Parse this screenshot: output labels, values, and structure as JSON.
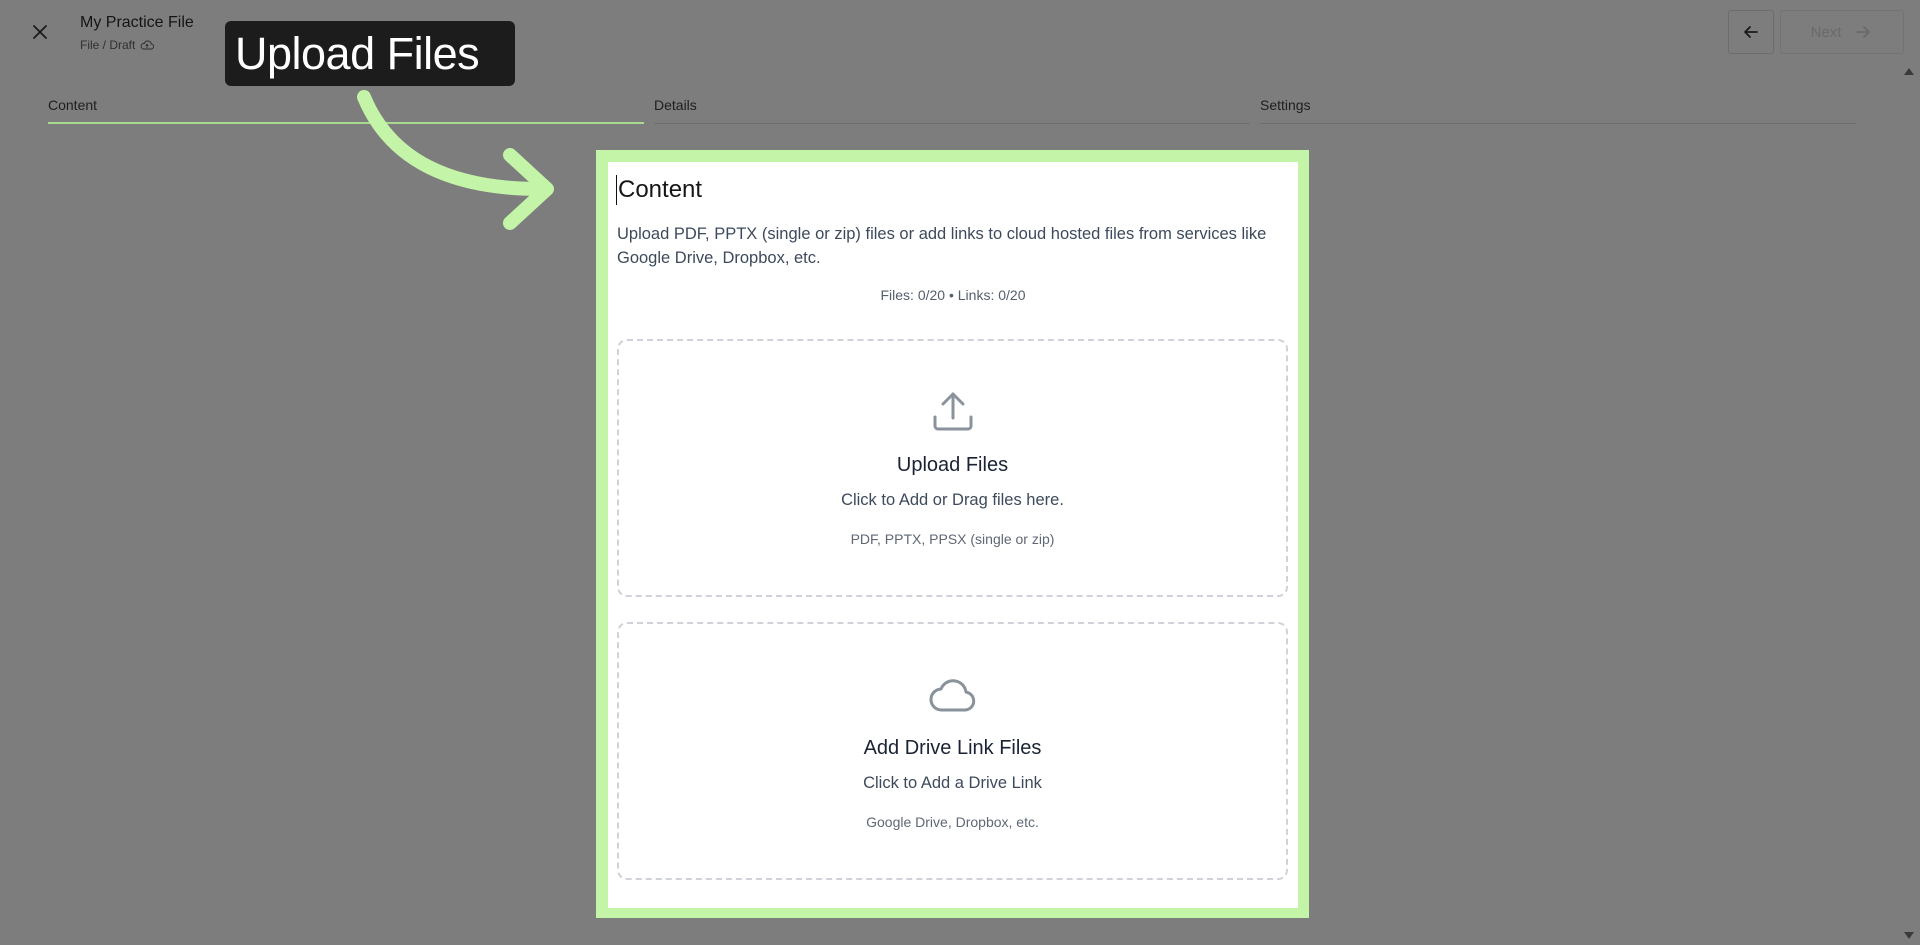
{
  "header": {
    "title": "My Practice File",
    "breadcrumb": "File / Draft",
    "close_icon": "close-icon",
    "cloud_status_icon": "cloud-icon",
    "back_icon": "arrow-left-icon",
    "next_label": "Next",
    "next_icon": "arrow-right-icon"
  },
  "stepper": {
    "steps": [
      {
        "label": "Content",
        "active": true
      },
      {
        "label": "Details",
        "active": false
      },
      {
        "label": "Settings",
        "active": false
      }
    ]
  },
  "callout": {
    "label": "Upload Files"
  },
  "content": {
    "title": "Content",
    "description": "Upload PDF, PPTX (single or zip) files or add links to cloud hosted files from services like Google Drive, Dropbox, etc.",
    "counts": "Files: 0/20 • Links: 0/20",
    "upload": {
      "icon": "upload-icon",
      "title": "Upload Files",
      "subtitle": "Click to Add or Drag files here.",
      "hint": "PDF, PPTX, PPSX (single or zip)"
    },
    "drive": {
      "icon": "cloud-icon",
      "title": "Add Drive Link Files",
      "subtitle": "Click to Add a Drive Link",
      "hint": "Google Drive, Dropbox, etc."
    }
  },
  "colors": {
    "overlay": "#7d7d7d",
    "highlight": "#c4f4a8",
    "active_step": "#a8d98e",
    "callout_bg": "#1c1c1c"
  }
}
